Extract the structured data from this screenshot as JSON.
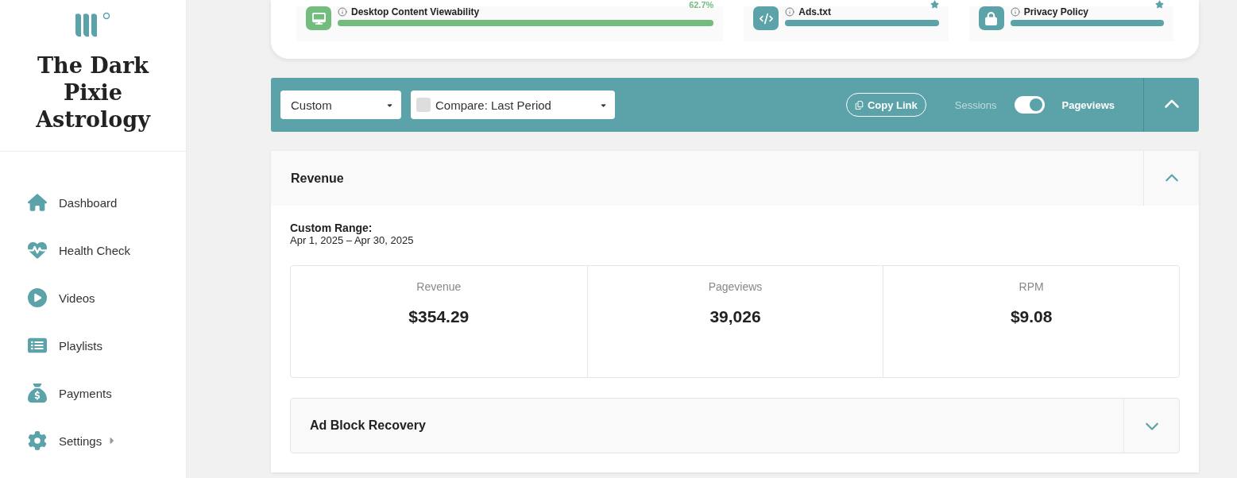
{
  "sidebar": {
    "brand": "The Dark Pixie Astrology",
    "items": [
      {
        "label": "Dashboard",
        "submenu": false
      },
      {
        "label": "Health Check",
        "submenu": false
      },
      {
        "label": "Videos",
        "submenu": false
      },
      {
        "label": "Playlists",
        "submenu": false
      },
      {
        "label": "Payments",
        "submenu": false
      },
      {
        "label": "Settings",
        "submenu": true
      }
    ]
  },
  "health_checks": [
    {
      "title": "Desktop Content Viewability",
      "color": "#72bd7e",
      "level": 1,
      "reading": "62.7%",
      "starred": false
    },
    {
      "title": "Ads.txt",
      "color": "#5ba3a8",
      "level": 1,
      "starred": true
    },
    {
      "title": "Privacy Policy",
      "color": "#5ba3a8",
      "level": 1,
      "starred": true
    }
  ],
  "toolbar": {
    "range": "Custom",
    "compare": {
      "label": "Compare: Last Period",
      "checked": false
    },
    "copy_link": "Copy Link",
    "toggle": {
      "left": "Sessions",
      "right": "Pageviews",
      "on": true
    },
    "expanded": true
  },
  "revenue": {
    "title": "Revenue",
    "expanded": true,
    "range_label": "Custom Range:",
    "range": "Apr 1, 2025 – Apr 30, 2025",
    "metrics": [
      {
        "label": "Revenue",
        "value": "$354.29"
      },
      {
        "label": "Pageviews",
        "value": "39,026"
      },
      {
        "label": "RPM",
        "value": "$9.08"
      }
    ],
    "sections": [
      {
        "title": "Ad Block Recovery",
        "expanded": false
      }
    ]
  }
}
